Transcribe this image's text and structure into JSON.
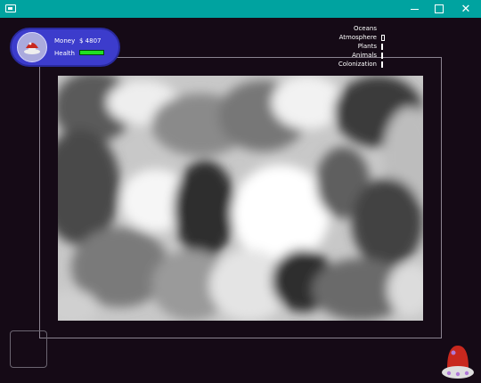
{
  "window": {
    "app_icon": "window-icon",
    "controls": [
      "minimize",
      "maximize",
      "close"
    ],
    "titlebar_color": "#00a3a0"
  },
  "hud": {
    "money_label": "Money",
    "money_value": "$ 4807",
    "health_label": "Health",
    "health_level": 1.0,
    "avatar_icon": "mushroom-icon",
    "panel_color": "#3c3ccc",
    "health_color": "#22e022"
  },
  "planet_stats": [
    {
      "label": "Oceans",
      "bar": false
    },
    {
      "label": "Atmosphere",
      "bar": true,
      "wide": true
    },
    {
      "label": "Plants",
      "bar": true,
      "wide": false
    },
    {
      "label": "Animals",
      "bar": true,
      "wide": false
    },
    {
      "label": "Colonization",
      "bar": true,
      "wide": false
    }
  ],
  "map": {
    "description_icon": "heightmap"
  },
  "robot": {
    "icon": "robot-icon",
    "body_color": "#c8281e",
    "base_color": "#dedede"
  },
  "background_color": "#150a16"
}
